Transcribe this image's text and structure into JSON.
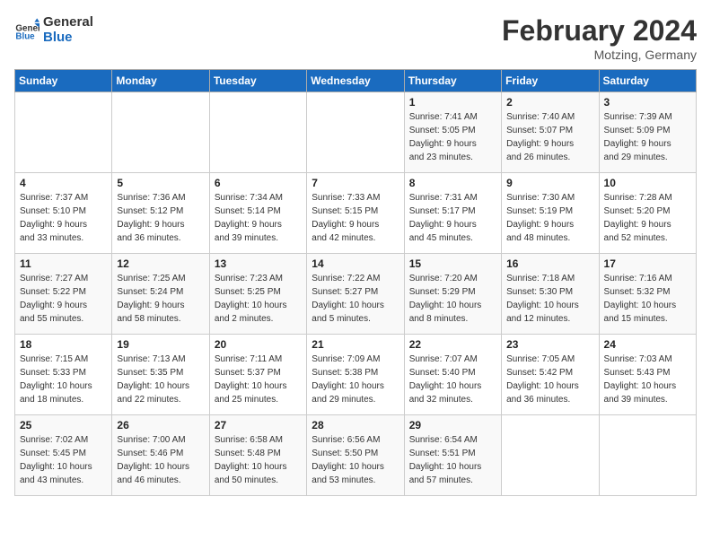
{
  "header": {
    "logo_line1": "General",
    "logo_line2": "Blue",
    "month": "February 2024",
    "location": "Motzing, Germany"
  },
  "days_of_week": [
    "Sunday",
    "Monday",
    "Tuesday",
    "Wednesday",
    "Thursday",
    "Friday",
    "Saturday"
  ],
  "weeks": [
    [
      {
        "num": "",
        "info": ""
      },
      {
        "num": "",
        "info": ""
      },
      {
        "num": "",
        "info": ""
      },
      {
        "num": "",
        "info": ""
      },
      {
        "num": "1",
        "info": "Sunrise: 7:41 AM\nSunset: 5:05 PM\nDaylight: 9 hours\nand 23 minutes."
      },
      {
        "num": "2",
        "info": "Sunrise: 7:40 AM\nSunset: 5:07 PM\nDaylight: 9 hours\nand 26 minutes."
      },
      {
        "num": "3",
        "info": "Sunrise: 7:39 AM\nSunset: 5:09 PM\nDaylight: 9 hours\nand 29 minutes."
      }
    ],
    [
      {
        "num": "4",
        "info": "Sunrise: 7:37 AM\nSunset: 5:10 PM\nDaylight: 9 hours\nand 33 minutes."
      },
      {
        "num": "5",
        "info": "Sunrise: 7:36 AM\nSunset: 5:12 PM\nDaylight: 9 hours\nand 36 minutes."
      },
      {
        "num": "6",
        "info": "Sunrise: 7:34 AM\nSunset: 5:14 PM\nDaylight: 9 hours\nand 39 minutes."
      },
      {
        "num": "7",
        "info": "Sunrise: 7:33 AM\nSunset: 5:15 PM\nDaylight: 9 hours\nand 42 minutes."
      },
      {
        "num": "8",
        "info": "Sunrise: 7:31 AM\nSunset: 5:17 PM\nDaylight: 9 hours\nand 45 minutes."
      },
      {
        "num": "9",
        "info": "Sunrise: 7:30 AM\nSunset: 5:19 PM\nDaylight: 9 hours\nand 48 minutes."
      },
      {
        "num": "10",
        "info": "Sunrise: 7:28 AM\nSunset: 5:20 PM\nDaylight: 9 hours\nand 52 minutes."
      }
    ],
    [
      {
        "num": "11",
        "info": "Sunrise: 7:27 AM\nSunset: 5:22 PM\nDaylight: 9 hours\nand 55 minutes."
      },
      {
        "num": "12",
        "info": "Sunrise: 7:25 AM\nSunset: 5:24 PM\nDaylight: 9 hours\nand 58 minutes."
      },
      {
        "num": "13",
        "info": "Sunrise: 7:23 AM\nSunset: 5:25 PM\nDaylight: 10 hours\nand 2 minutes."
      },
      {
        "num": "14",
        "info": "Sunrise: 7:22 AM\nSunset: 5:27 PM\nDaylight: 10 hours\nand 5 minutes."
      },
      {
        "num": "15",
        "info": "Sunrise: 7:20 AM\nSunset: 5:29 PM\nDaylight: 10 hours\nand 8 minutes."
      },
      {
        "num": "16",
        "info": "Sunrise: 7:18 AM\nSunset: 5:30 PM\nDaylight: 10 hours\nand 12 minutes."
      },
      {
        "num": "17",
        "info": "Sunrise: 7:16 AM\nSunset: 5:32 PM\nDaylight: 10 hours\nand 15 minutes."
      }
    ],
    [
      {
        "num": "18",
        "info": "Sunrise: 7:15 AM\nSunset: 5:33 PM\nDaylight: 10 hours\nand 18 minutes."
      },
      {
        "num": "19",
        "info": "Sunrise: 7:13 AM\nSunset: 5:35 PM\nDaylight: 10 hours\nand 22 minutes."
      },
      {
        "num": "20",
        "info": "Sunrise: 7:11 AM\nSunset: 5:37 PM\nDaylight: 10 hours\nand 25 minutes."
      },
      {
        "num": "21",
        "info": "Sunrise: 7:09 AM\nSunset: 5:38 PM\nDaylight: 10 hours\nand 29 minutes."
      },
      {
        "num": "22",
        "info": "Sunrise: 7:07 AM\nSunset: 5:40 PM\nDaylight: 10 hours\nand 32 minutes."
      },
      {
        "num": "23",
        "info": "Sunrise: 7:05 AM\nSunset: 5:42 PM\nDaylight: 10 hours\nand 36 minutes."
      },
      {
        "num": "24",
        "info": "Sunrise: 7:03 AM\nSunset: 5:43 PM\nDaylight: 10 hours\nand 39 minutes."
      }
    ],
    [
      {
        "num": "25",
        "info": "Sunrise: 7:02 AM\nSunset: 5:45 PM\nDaylight: 10 hours\nand 43 minutes."
      },
      {
        "num": "26",
        "info": "Sunrise: 7:00 AM\nSunset: 5:46 PM\nDaylight: 10 hours\nand 46 minutes."
      },
      {
        "num": "27",
        "info": "Sunrise: 6:58 AM\nSunset: 5:48 PM\nDaylight: 10 hours\nand 50 minutes."
      },
      {
        "num": "28",
        "info": "Sunrise: 6:56 AM\nSunset: 5:50 PM\nDaylight: 10 hours\nand 53 minutes."
      },
      {
        "num": "29",
        "info": "Sunrise: 6:54 AM\nSunset: 5:51 PM\nDaylight: 10 hours\nand 57 minutes."
      },
      {
        "num": "",
        "info": ""
      },
      {
        "num": "",
        "info": ""
      }
    ]
  ]
}
